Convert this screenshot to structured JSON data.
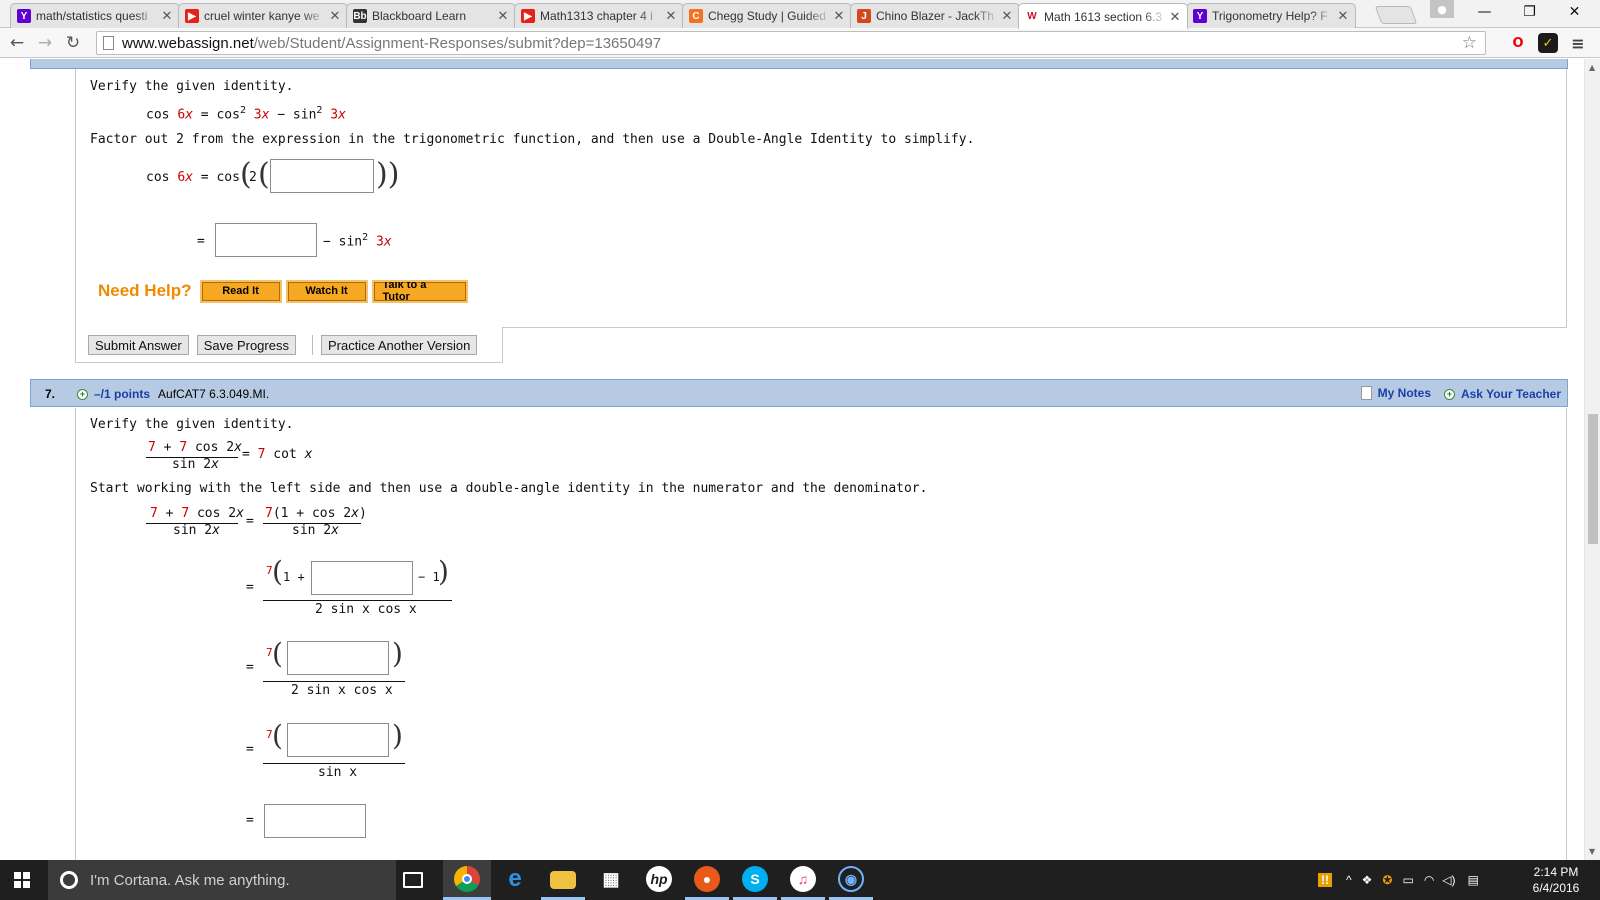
{
  "browser": {
    "tabs": [
      {
        "title": "math/statistics questi",
        "icon": "yahoo-icon",
        "color": "#5f01d1",
        "glyph": "Y"
      },
      {
        "title": "cruel winter kanye we",
        "icon": "youtube-icon",
        "color": "#e62117",
        "glyph": "▶"
      },
      {
        "title": "Blackboard Learn",
        "icon": "blackboard-icon",
        "color": "#333333",
        "glyph": "Bb"
      },
      {
        "title": "Math1313 chapter 4 i",
        "icon": "youtube-icon",
        "color": "#e62117",
        "glyph": "▶"
      },
      {
        "title": "Chegg Study | Guided",
        "icon": "chegg-icon",
        "color": "#f4721f",
        "glyph": "C"
      },
      {
        "title": "Chino Blazer - JackTh",
        "icon": "jackthreads-icon",
        "color": "#d04a1e",
        "glyph": "J"
      },
      {
        "title": "Math 1613 section 6.3",
        "icon": "webassign-icon",
        "color": "#c8102e",
        "glyph": "W"
      },
      {
        "title": "Trigonometry Help? F",
        "icon": "yahoo-icon",
        "color": "#5f01d1",
        "glyph": "Y"
      }
    ],
    "active_tab": 6,
    "url_host": "www.webassign.net",
    "url_path": "/web/Student/Assignment-Responses/submit?dep=13650497"
  },
  "q6": {
    "prompt": "Verify the given identity.",
    "identity": {
      "l1": "cos ",
      "l2": "6",
      "l3": "x",
      "l4": " = cos",
      "l5": "2",
      "l6": " 3",
      "l7": "x",
      "l8": " − sin",
      "l9": "2",
      "l10": " 3",
      "l11": "x"
    },
    "instruction": "Factor out 2 from the expression in the trigonometric function, and then use a Double-Angle Identity to simplify.",
    "step1": {
      "a": "cos ",
      "b": "6",
      "c": "x",
      "d": " = cos",
      "two": "2"
    },
    "step2": {
      "eq": "=",
      "minus": "− sin",
      "sup": "2",
      "three": " 3",
      "x": "x"
    },
    "help_label": "Need Help?",
    "help_buttons": [
      "Read It",
      "Watch It",
      "Talk to a Tutor"
    ],
    "buttons": {
      "submit": "Submit Answer",
      "save": "Save Progress",
      "practice": "Practice Another Version"
    }
  },
  "q7": {
    "number": "7.",
    "points": "–/1 points",
    "code": "AufCAT7 6.3.049.MI.",
    "my_notes": "My Notes",
    "ask_teacher": "Ask Your Teacher",
    "prompt": "Verify the given identity.",
    "id_num": {
      "a": "7",
      "b": " + ",
      "c": "7",
      "d": " cos 2",
      "e": "x"
    },
    "id_den": {
      "a": "sin 2",
      "b": "x"
    },
    "id_rhs": {
      "eq": "= ",
      "seven": "7",
      "rest": " cot ",
      "x": "x"
    },
    "instruction": "Start working with the left side and then use a double-angle identity in the numerator and the denominator.",
    "w_num": {
      "a": "7",
      "b": " + ",
      "c": "7",
      "d": " cos 2",
      "e": "x"
    },
    "w_den": {
      "a": "sin 2",
      "b": "x"
    },
    "w_eq": "=",
    "w_rnum": {
      "a": "7",
      "b": "(1 + cos 2",
      "c": "x",
      "d": ")"
    },
    "w_rden": {
      "a": "sin 2",
      "b": "x"
    },
    "s2": {
      "eq": "=",
      "seven": "7",
      "onep": "1 +",
      "minus1": "− 1",
      "den": "2 sin x cos x"
    },
    "s3": {
      "eq": "=",
      "seven": "7",
      "den": "2 sin x cos x"
    },
    "s4": {
      "eq": "=",
      "seven": "7",
      "den": "sin x"
    },
    "s5": {
      "eq": "="
    }
  },
  "taskbar": {
    "cortana": "I'm Cortana. Ask me anything.",
    "time": "2:14 PM",
    "date": "6/4/2016"
  }
}
